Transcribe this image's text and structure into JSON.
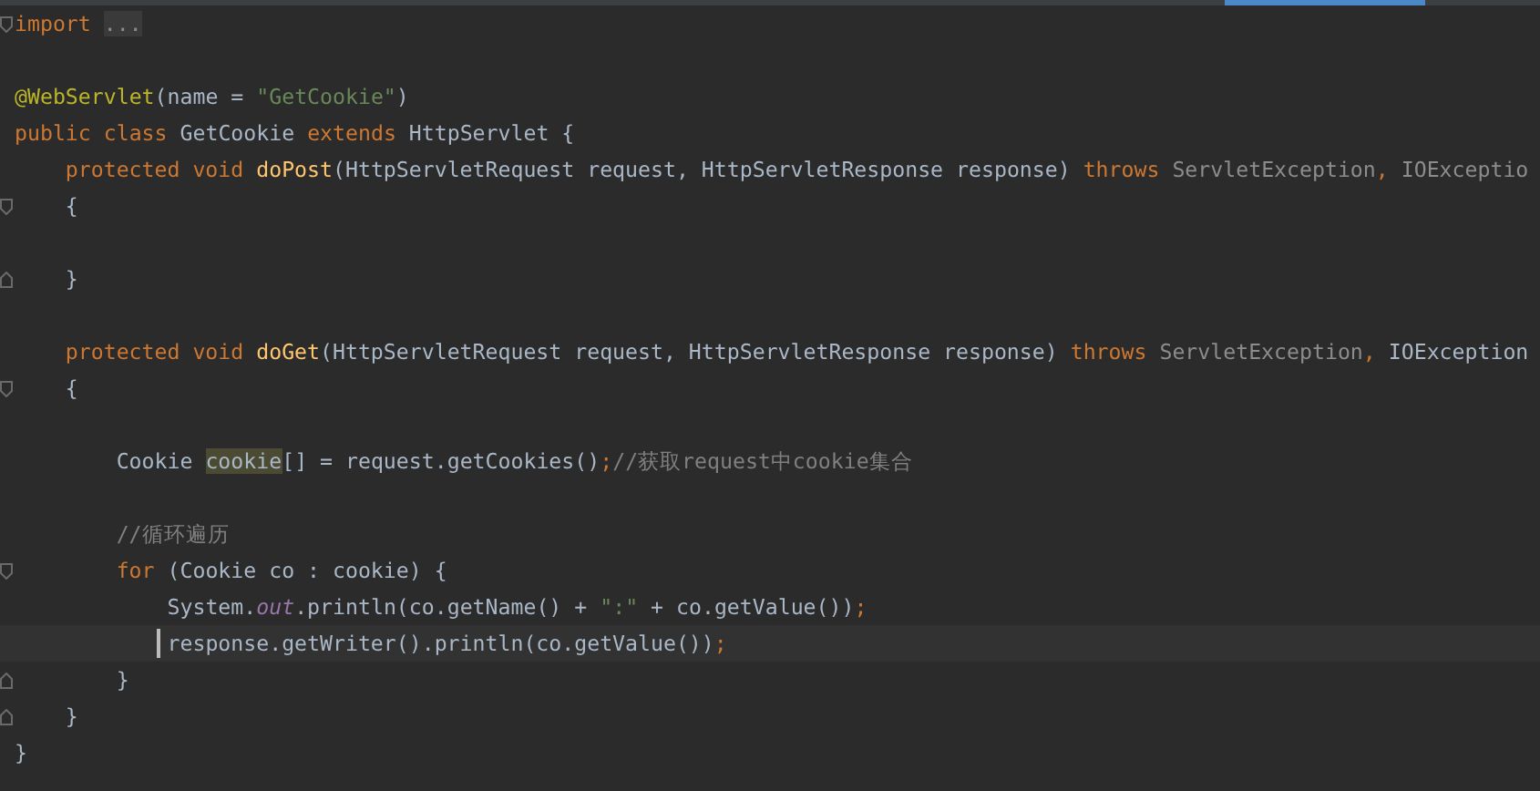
{
  "editor": {
    "lines": [
      {
        "kind": "code",
        "fold_open": true,
        "tokens": [
          {
            "kind": "keyword",
            "text": "import"
          },
          {
            "kind": "folded",
            "text": "..."
          }
        ]
      },
      {
        "kind": "blank"
      },
      {
        "kind": "code",
        "tokens": [
          {
            "kind": "annotation",
            "text": "@WebServlet"
          },
          {
            "kind": "plain",
            "text": "(name = "
          },
          {
            "kind": "string",
            "text": "\"GetCookie\""
          },
          {
            "kind": "plain",
            "text": ")"
          }
        ]
      },
      {
        "kind": "code",
        "tokens": [
          {
            "kind": "keyword",
            "text": "public class "
          },
          {
            "kind": "plain",
            "text": "GetCookie "
          },
          {
            "kind": "keyword",
            "text": "extends "
          },
          {
            "kind": "plain",
            "text": "HttpServlet {"
          }
        ],
        "children": [
          {
            "kind": "code",
            "tokens": [
              {
                "kind": "keyword",
                "text": "protected void "
              },
              {
                "kind": "method",
                "text": "doPost"
              },
              {
                "kind": "plain",
                "text": "(HttpServletRequest request, HttpServletResponse response) "
              },
              {
                "kind": "keyword",
                "text": "throws "
              },
              {
                "kind": "muted",
                "text": "ServletException"
              },
              {
                "kind": "keyword",
                "text": ", "
              },
              {
                "kind": "muted",
                "text": "IOExceptio"
              }
            ]
          },
          {
            "kind": "code",
            "fold_open": true,
            "tokens": [
              {
                "kind": "plain",
                "text": "{"
              }
            ]
          },
          {
            "kind": "blank"
          },
          {
            "kind": "code",
            "fold_close": true,
            "tokens": [
              {
                "kind": "plain",
                "text": "}"
              }
            ]
          },
          {
            "kind": "blank"
          },
          {
            "kind": "code",
            "tokens": [
              {
                "kind": "keyword",
                "text": "protected void "
              },
              {
                "kind": "method",
                "text": "doGet"
              },
              {
                "kind": "plain",
                "text": "(HttpServletRequest request, HttpServletResponse response) "
              },
              {
                "kind": "keyword",
                "text": "throws "
              },
              {
                "kind": "muted",
                "text": "ServletException"
              },
              {
                "kind": "keyword",
                "text": ", "
              },
              {
                "kind": "plain",
                "text": "IOException"
              }
            ]
          },
          {
            "kind": "code",
            "fold_open": true,
            "tokens": [
              {
                "kind": "plain",
                "text": "{"
              }
            ],
            "children": [
              {
                "kind": "blank"
              },
              {
                "kind": "code",
                "tokens": [
                  {
                    "kind": "plain",
                    "text": "Cookie "
                  },
                  {
                    "kind": "highlight",
                    "text": "cookie"
                  },
                  {
                    "kind": "plain",
                    "text": "[] = request.getCookies()"
                  },
                  {
                    "kind": "keyword",
                    "text": ";"
                  },
                  {
                    "kind": "comment",
                    "text": "//获取request中cookie集合"
                  }
                ]
              },
              {
                "kind": "blank"
              },
              {
                "kind": "code",
                "tokens": [
                  {
                    "kind": "comment",
                    "text": "//循环遍历"
                  }
                ]
              },
              {
                "kind": "code",
                "fold_open": true,
                "tokens": [
                  {
                    "kind": "keyword",
                    "text": "for "
                  },
                  {
                    "kind": "plain",
                    "text": "(Cookie co : cookie) {"
                  }
                ],
                "children": [
                  {
                    "kind": "code",
                    "tokens": [
                      {
                        "kind": "plain",
                        "text": "System."
                      },
                      {
                        "kind": "field",
                        "text": "out"
                      },
                      {
                        "kind": "plain",
                        "text": ".println(co.getName() + "
                      },
                      {
                        "kind": "string",
                        "text": "\":\""
                      },
                      {
                        "kind": "plain",
                        "text": " + co.getValue())"
                      },
                      {
                        "kind": "keyword",
                        "text": ";"
                      }
                    ]
                  },
                  {
                    "kind": "code",
                    "current": true,
                    "tokens": [
                      {
                        "kind": "plain",
                        "text": "response.getWriter().println(co.getValue())"
                      },
                      {
                        "kind": "keyword",
                        "text": ";"
                      }
                    ]
                  }
                ]
              },
              {
                "kind": "code",
                "fold_close": true,
                "tokens": [
                  {
                    "kind": "plain",
                    "text": "}"
                  }
                ]
              }
            ]
          },
          {
            "kind": "code",
            "fold_close": true,
            "tokens": [
              {
                "kind": "plain",
                "text": "}"
              }
            ]
          }
        ]
      },
      {
        "kind": "code",
        "tokens": [
          {
            "kind": "plain",
            "text": "}"
          }
        ]
      }
    ]
  }
}
